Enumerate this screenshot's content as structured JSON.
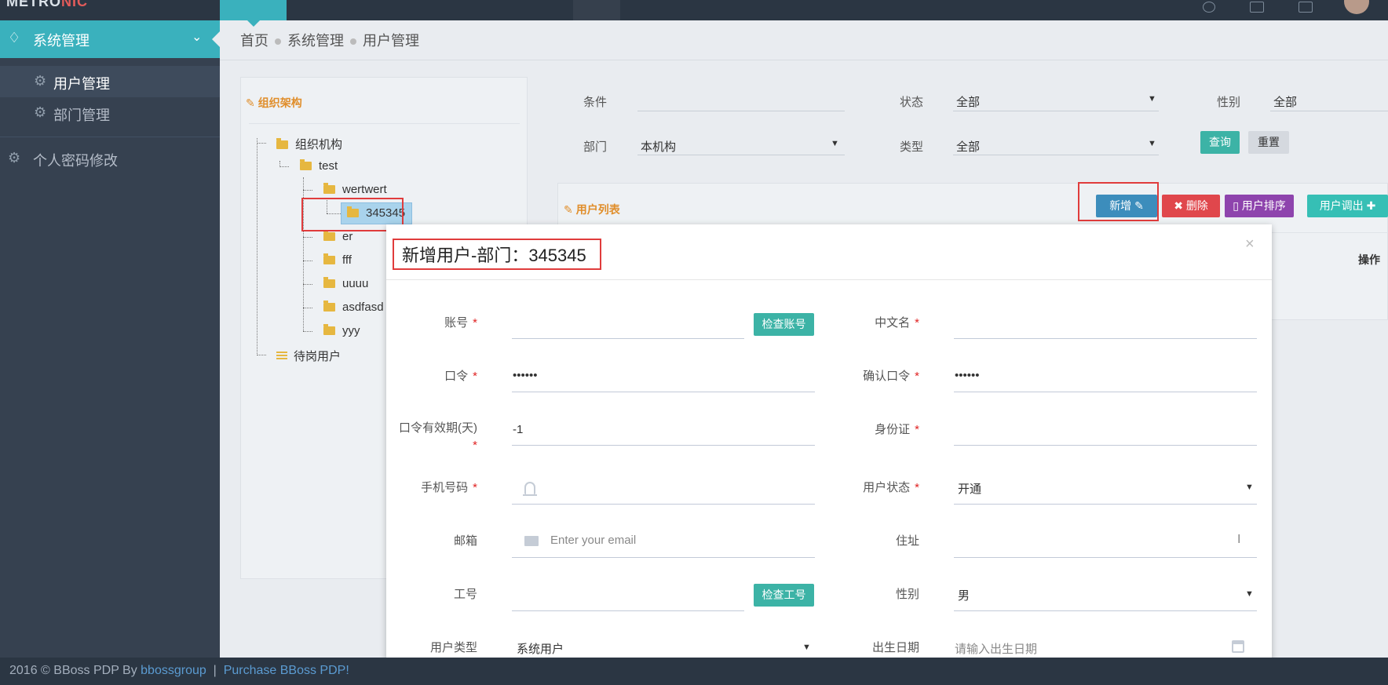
{
  "topbar": {
    "brand_main": "METRO",
    "brand_accent": "NIC"
  },
  "sidebar": {
    "section_label": "系统管理",
    "items": [
      {
        "label": "用户管理"
      },
      {
        "label": "部门管理"
      }
    ],
    "password_label": "个人密码修改"
  },
  "breadcrumb": [
    "首页",
    "系统管理",
    "用户管理"
  ],
  "org_tree": {
    "title": "组织架构",
    "root": "组织机构",
    "nodes": [
      "test",
      "wertwert",
      "345345",
      "er",
      "fff",
      "uuuu",
      "asdfasd",
      "yyy"
    ],
    "pending": "待岗用户"
  },
  "search": {
    "condition_label": "条件",
    "condition_value": "",
    "status_label": "状态",
    "status_value": "全部",
    "gender_label": "性别",
    "gender_value": "全部",
    "dept_label": "部门",
    "dept_value": "本机构",
    "type_label": "类型",
    "type_value": "全部",
    "query_btn": "查询",
    "reset_btn": "重置"
  },
  "user_list": {
    "title": "用户列表",
    "add_btn": "新增",
    "delete_btn": "删除",
    "sort_btn": "用户排序",
    "transfer_btn": "用户调出",
    "col_operation": "操作"
  },
  "modal": {
    "title": "新增用户-部门：345345",
    "close": "×",
    "fields": {
      "account_label": "账号",
      "check_account_btn": "检查账号",
      "cn_name_label": "中文名",
      "password_label": "口令",
      "password_value": "••••••",
      "confirm_password_label": "确认口令",
      "confirm_password_value": "••••••",
      "password_validity_label": "口令有效期(天)",
      "password_validity_value": "-1",
      "id_card_label": "身份证",
      "mobile_label": "手机号码",
      "user_status_label": "用户状态",
      "user_status_value": "开通",
      "email_label": "邮箱",
      "email_placeholder": "Enter your email",
      "address_label": "住址",
      "employee_no_label": "工号",
      "check_employee_no_btn": "检查工号",
      "gender_label": "性别",
      "gender_value": "男",
      "user_type_label": "用户类型",
      "user_type_value": "系统用户",
      "birthday_label": "出生日期",
      "birthday_placeholder": "请输入出生日期",
      "required_mark": "*"
    }
  },
  "footer": {
    "copyright": "2016 © BBoss PDP By",
    "company_link": "bbossgroup",
    "separator": "|",
    "purchase_link": "Purchase BBoss PDP!"
  },
  "colors": {
    "sidebar_bg": "#364150",
    "accent_teal": "#3ab1bd",
    "add_blue": "#3c8dbc",
    "delete_red": "#e0474c",
    "sort_purple": "#8e44ad",
    "transfer_teal": "#36bfb5",
    "highlight_red": "#e03c3c"
  }
}
